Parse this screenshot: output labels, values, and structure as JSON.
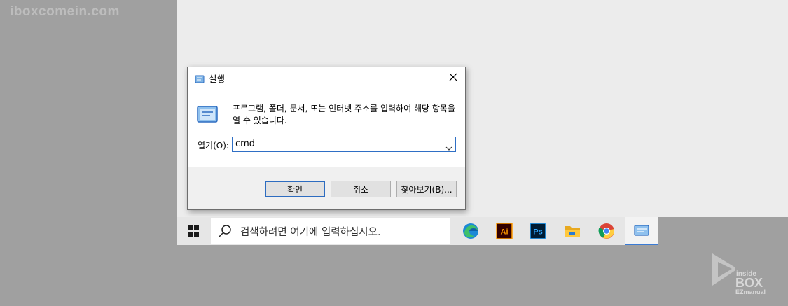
{
  "watermark": {
    "text": "iboxcomein.com"
  },
  "dialog": {
    "title": "실행",
    "description": "프로그램, 폴더, 문서, 또는 인터넷 주소를 입력하여 해당 항목을 열 수 있습니다.",
    "open_label": "열기(O):",
    "input_value": "cmd",
    "buttons": {
      "ok": "확인",
      "cancel": "취소",
      "browse": "찾아보기(B)..."
    }
  },
  "taskbar": {
    "search_placeholder": "검색하려면 여기에 입력하십시오.",
    "apps": [
      {
        "name": "edge",
        "icon": "edge-icon"
      },
      {
        "name": "illustrator",
        "icon": "illustrator-icon",
        "label": "Ai"
      },
      {
        "name": "photoshop",
        "icon": "photoshop-icon",
        "label": "Ps"
      },
      {
        "name": "file-explorer",
        "icon": "folder-icon"
      },
      {
        "name": "chrome",
        "icon": "chrome-icon"
      },
      {
        "name": "run",
        "icon": "run-icon",
        "active": true
      }
    ]
  },
  "logo": {
    "line1": "inside",
    "line2": "BOX",
    "line3": "EZmanual"
  },
  "colors": {
    "accent": "#2d6cc0",
    "desktop": "#ececec",
    "background": "#a0a0a0",
    "taskbar": "#e6e6e6"
  }
}
